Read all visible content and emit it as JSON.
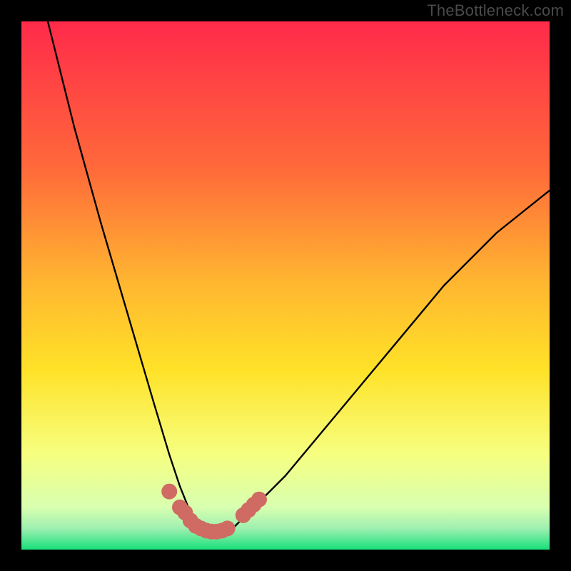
{
  "watermark": "TheBottleneck.com",
  "chart_data": {
    "type": "line",
    "title": "",
    "xlabel": "",
    "ylabel": "",
    "xlim": [
      0,
      100
    ],
    "ylim": [
      0,
      100
    ],
    "series": [
      {
        "name": "curve",
        "note": "V-shaped curve: steep descent from upper-left, dip near x≈35, rise to right edge",
        "x": [
          5,
          10,
          15,
          20,
          25,
          28,
          30,
          32,
          34,
          36,
          38,
          40,
          42,
          45,
          50,
          60,
          70,
          80,
          90,
          100
        ],
        "y": [
          100,
          80,
          62,
          45,
          28,
          18,
          12,
          7,
          4,
          3,
          3,
          4,
          6,
          9,
          14,
          26,
          38,
          50,
          60,
          68
        ]
      }
    ],
    "background_gradient": {
      "top": "#ff2a4a",
      "mid_upper": "#ffa030",
      "mid": "#ffe228",
      "mid_lower": "#f6ff80",
      "band": "#d8ffb0",
      "bottom": "#18e07a"
    },
    "marker_band": {
      "note": "Thick salmon markers tracing curve segment just above the dip band (visible points)",
      "color": "#cf6b63",
      "x": [
        28,
        30,
        31,
        32,
        33,
        34,
        35,
        36,
        37,
        38,
        39,
        42,
        43,
        44,
        45
      ],
      "y": [
        11,
        8,
        7,
        5.5,
        4.5,
        4,
        3.6,
        3.4,
        3.4,
        3.6,
        4,
        6.5,
        7.5,
        8.5,
        9.5
      ]
    }
  }
}
